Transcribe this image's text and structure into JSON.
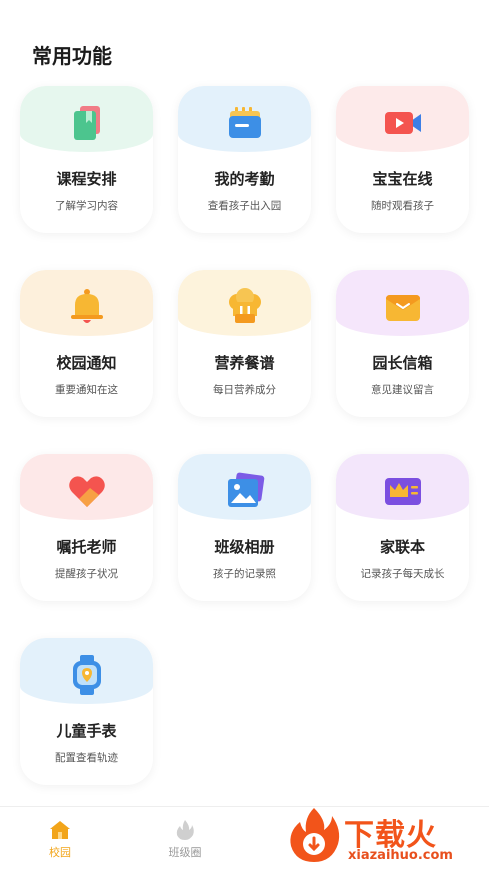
{
  "section_title": "常用功能",
  "cards": [
    {
      "name": "课程安排",
      "desc": "了解学习内容",
      "icon": "book-icon",
      "bg": "#e6f7ee"
    },
    {
      "name": "我的考勤",
      "desc": "查看孩子出入园",
      "icon": "folder-icon",
      "bg": "#e3f1fb"
    },
    {
      "name": "宝宝在线",
      "desc": "随时观看孩子",
      "icon": "video-camera-icon",
      "bg": "#fdeaea"
    },
    {
      "name": "校园通知",
      "desc": "重要通知在这",
      "icon": "bell-icon",
      "bg": "#fdf0dc"
    },
    {
      "name": "营养餐谱",
      "desc": "每日营养成分",
      "icon": "chef-hat-icon",
      "bg": "#fdf3dc"
    },
    {
      "name": "园长信箱",
      "desc": "意见建议留言",
      "icon": "envelope-icon",
      "bg": "#f5e6fb"
    },
    {
      "name": "嘱托老师",
      "desc": "提醒孩子状况",
      "icon": "heart-icon",
      "bg": "#fde8e8"
    },
    {
      "name": "班级相册",
      "desc": "孩子的记录照",
      "icon": "photo-album-icon",
      "bg": "#e3f1fb"
    },
    {
      "name": "家联本",
      "desc": "记录孩子每天成长",
      "icon": "crown-card-icon",
      "bg": "#f3e6fb"
    },
    {
      "name": "儿童手表",
      "desc": "配置查看轨迹",
      "icon": "smartwatch-icon",
      "bg": "#e3f1fb"
    }
  ],
  "tabbar": {
    "home_label": "校园",
    "class_label": "班级圈",
    "active_color": "#f2a51a"
  },
  "watermark": {
    "text": "下载火",
    "url": "xiazaihuo.com"
  }
}
